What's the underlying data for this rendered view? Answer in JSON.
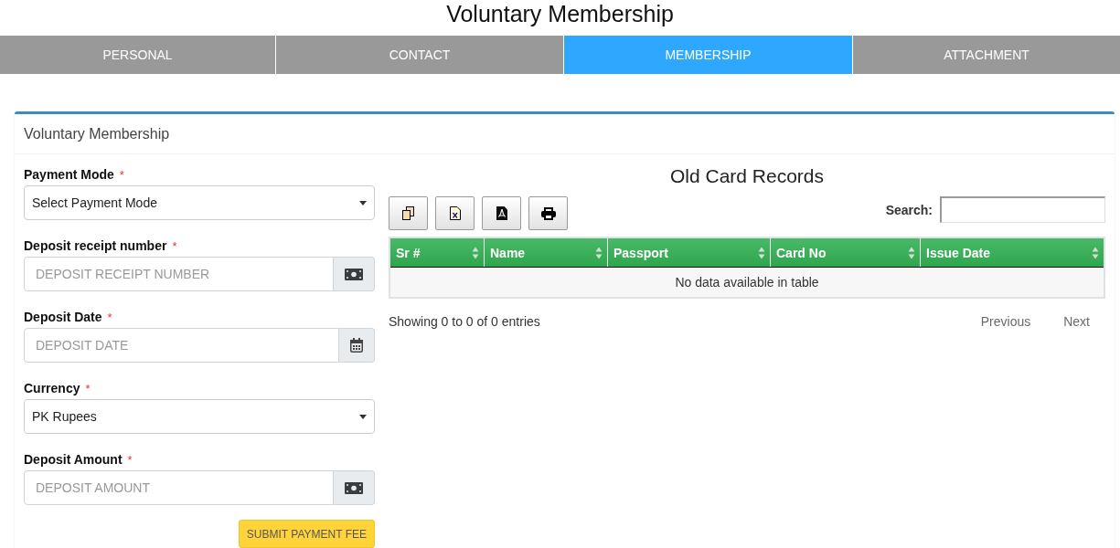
{
  "page_title": "Voluntary Membership",
  "tabs": [
    {
      "label": "PERSONAL",
      "selected": false
    },
    {
      "label": "CONTACT",
      "selected": false
    },
    {
      "label": "MEMBERSHIP",
      "selected": true
    },
    {
      "label": "ATTACHMENT",
      "selected": false
    }
  ],
  "card": {
    "title": "Voluntary Membership"
  },
  "form": {
    "fields": [
      {
        "kind": "select",
        "label": "Payment Mode",
        "required_mark": "*",
        "value": "Select Payment Mode"
      },
      {
        "kind": "text",
        "label": "Deposit receipt number",
        "required_mark": "*",
        "placeholder": "DEPOSIT RECEIPT NUMBER"
      },
      {
        "kind": "date",
        "label": "Deposit Date",
        "required_mark": "*",
        "placeholder": "DEPOSIT DATE"
      },
      {
        "kind": "select",
        "label": "Currency",
        "required_mark": "*",
        "value": "PK Rupees"
      },
      {
        "kind": "text",
        "label": "Deposit Amount",
        "required_mark": "*",
        "placeholder": "DEPOSIT AMOUNT"
      }
    ],
    "submit_button": "SUBMIT PAYMENT FEE"
  },
  "old_card_records": {
    "title": "Old Card Records",
    "search": {
      "label": "Search:"
    },
    "table": {
      "columns": [
        "Sr #",
        "Name",
        "Passport",
        "Card No",
        "Issue Date"
      ],
      "empty_message": "No data available in table"
    },
    "info": "Showing 0 to 0 of 0 entries",
    "pagination": [
      "Previous",
      "Next"
    ]
  }
}
